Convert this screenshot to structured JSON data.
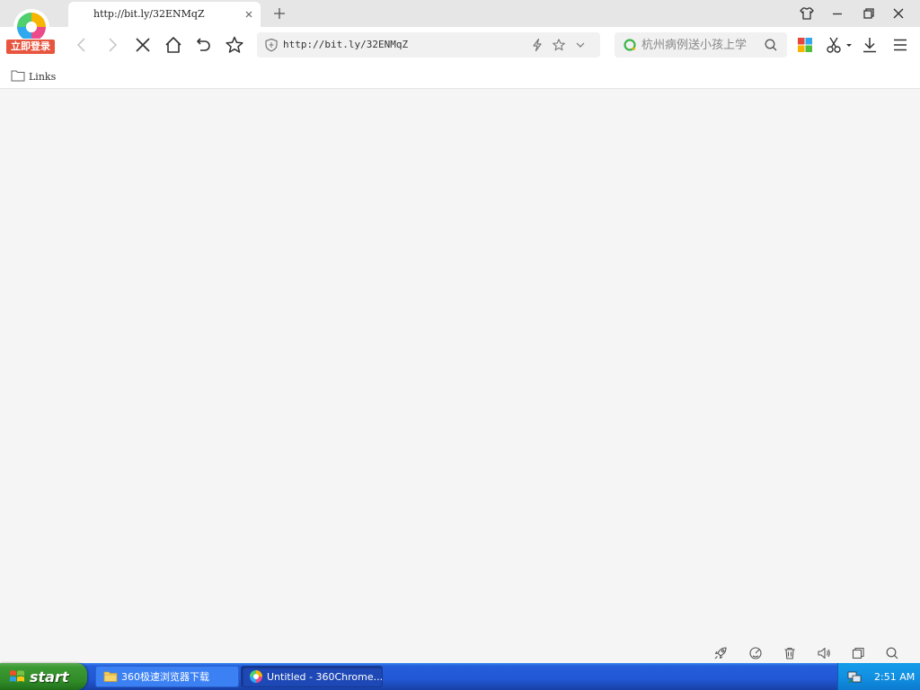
{
  "browser": {
    "login_badge": "立即登录",
    "active_tab": {
      "title": "http://bit.ly/32ENMqZ"
    },
    "address_bar": {
      "url": "http://bit.ly/32ENMqZ"
    },
    "search": {
      "placeholder": "杭州病例送小孩上学"
    },
    "bookmarks": [
      {
        "label": "Links"
      }
    ],
    "colors": {
      "login_badge": "#e8553e",
      "tab_strip": "#e6e6e6",
      "content_bg": "#f5f5f5"
    }
  },
  "taskbar": {
    "start_label": "start",
    "items": [
      {
        "label": "360极速浏览器下载",
        "icon": "folder-icon",
        "state": "inactive"
      },
      {
        "label": "Untitled - 360Chrome...",
        "icon": "360chrome-icon",
        "state": "active"
      }
    ],
    "clock": "2:51 AM",
    "colors": {
      "taskbar_blue": "#245edb",
      "start_green": "#3c9a33",
      "tray_blue": "#1290e2"
    }
  }
}
